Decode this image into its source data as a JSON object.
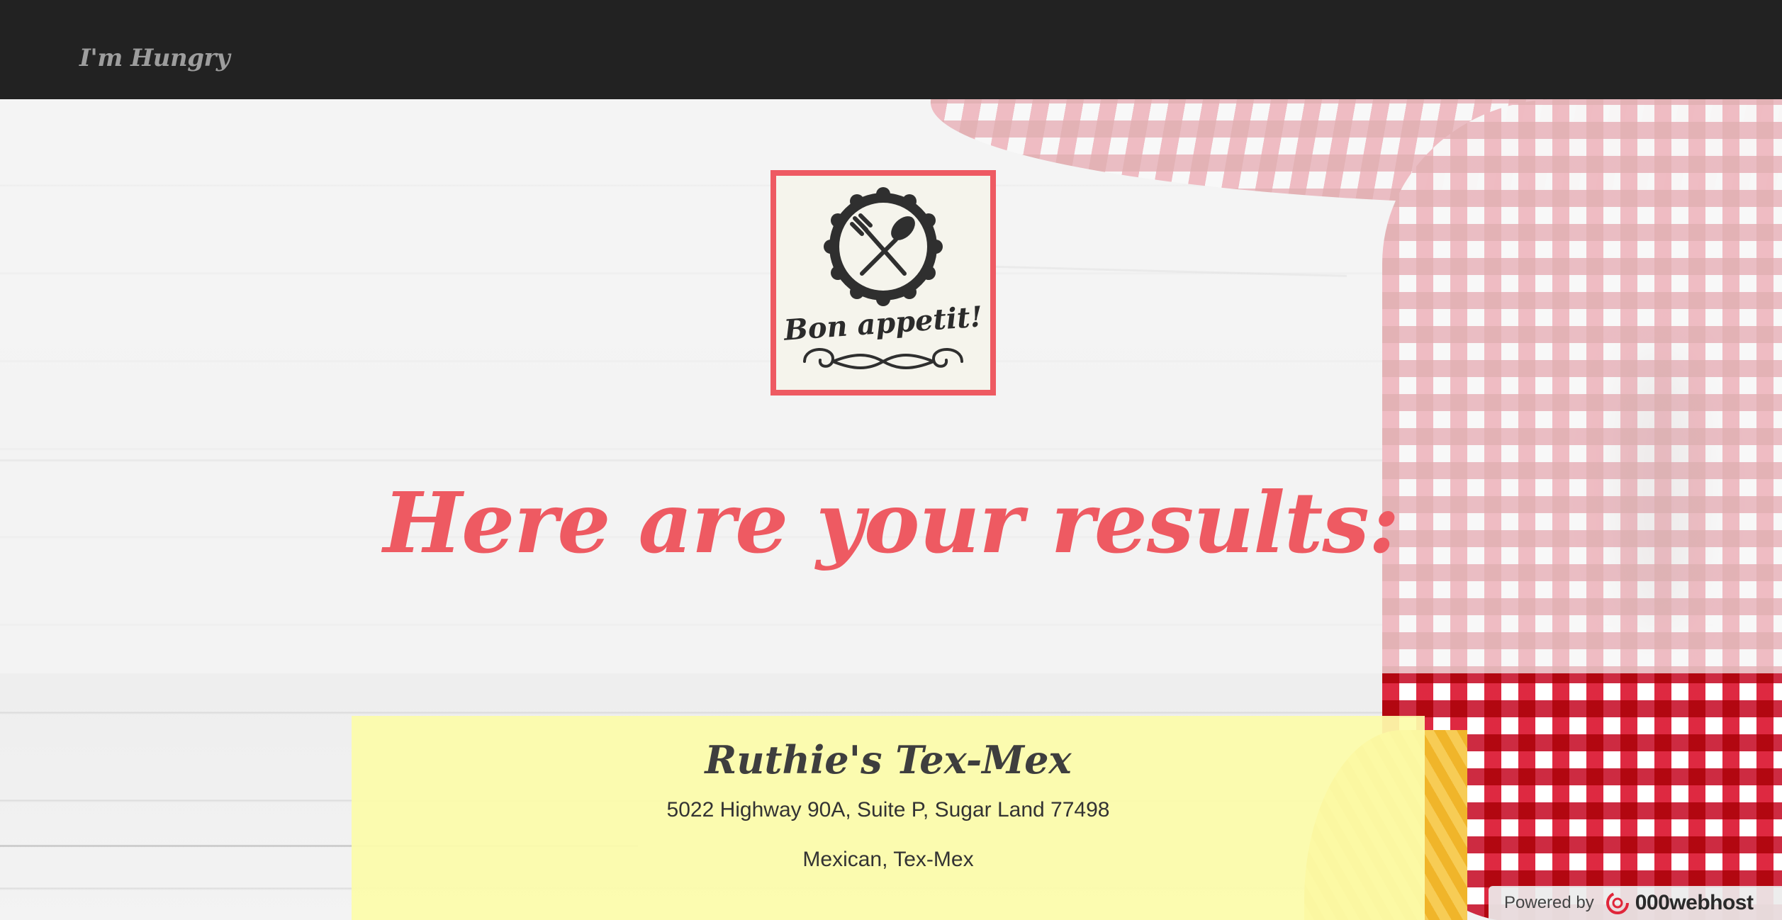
{
  "navbar": {
    "brand": "I'm Hungry"
  },
  "logo": {
    "text": "Bon appetit!",
    "icon": "fork-spoon-icon",
    "border_color": "#ee5a62"
  },
  "hero": {
    "heading": "Here are your results:",
    "heading_color": "#ee5a62"
  },
  "results": [
    {
      "name": "Ruthie's Tex-Mex",
      "address": "5022 Highway 90A, Suite P, Sugar Land 77498",
      "categories": "Mexican, Tex-Mex"
    }
  ],
  "badge": {
    "powered_by": "Powered by",
    "host_name": "000webhost",
    "icon": "000webhost-logo-icon"
  },
  "colors": {
    "navbar_bg": "#222222",
    "brand_text": "#9d9d9d",
    "card_bg": "#fcfcaa"
  }
}
